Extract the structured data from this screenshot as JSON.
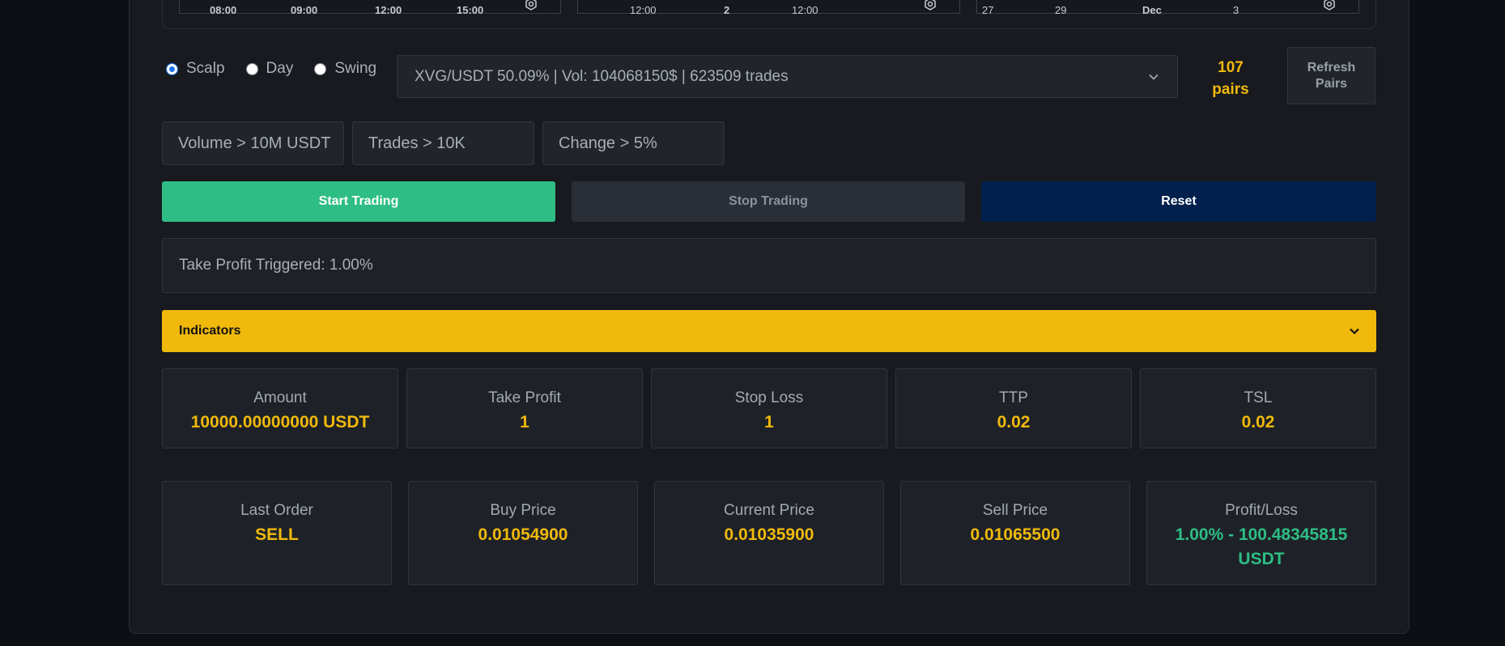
{
  "charts": [
    {
      "ticks": [
        "08:00",
        "09:00",
        "12:00",
        "15:00"
      ]
    },
    {
      "ticks": [
        "12:00",
        "2",
        "12:00"
      ]
    },
    {
      "ticks": [
        "27",
        "29",
        "Dec",
        "3"
      ]
    }
  ],
  "mode": {
    "options": [
      {
        "label": "Scalp",
        "checked": true
      },
      {
        "label": "Day",
        "checked": false
      },
      {
        "label": "Swing",
        "checked": false
      }
    ]
  },
  "pair_select": {
    "value": "XVG/USDT 50.09% | Vol: 104068150$ | 623509 trades"
  },
  "pairs_count": {
    "number": "107",
    "unit": "pairs"
  },
  "refresh": {
    "label_line1": "Refresh",
    "label_line2": "Pairs"
  },
  "filters": {
    "volume": "Volume > 10M USDT",
    "trades": "Trades > 10K",
    "change": "Change > 5%"
  },
  "actions": {
    "start": "Start Trading",
    "stop": "Stop Trading",
    "reset": "Reset"
  },
  "status": {
    "message": "Take Profit Triggered: 1.00%"
  },
  "indicators": {
    "label": "Indicators"
  },
  "settings": [
    {
      "label": "Amount",
      "value": "10000.00000000 USDT"
    },
    {
      "label": "Take Profit",
      "value": "1"
    },
    {
      "label": "Stop Loss",
      "value": "1"
    },
    {
      "label": "TTP",
      "value": "0.02"
    },
    {
      "label": "TSL",
      "value": "0.02"
    }
  ],
  "trade_stats": [
    {
      "label": "Last Order",
      "value": "SELL"
    },
    {
      "label": "Buy Price",
      "value": "0.01054900"
    },
    {
      "label": "Current Price",
      "value": "0.01035900"
    },
    {
      "label": "Sell Price",
      "value": "0.01065500"
    },
    {
      "label": "Profit/Loss",
      "value_line1": "1.00% - 100.48345815",
      "value_line2": "USDT"
    }
  ],
  "colors": {
    "accent": "#f0b90b",
    "positive": "#2ebd85",
    "reset_button": "#01204d",
    "panel": "#181a1f"
  }
}
